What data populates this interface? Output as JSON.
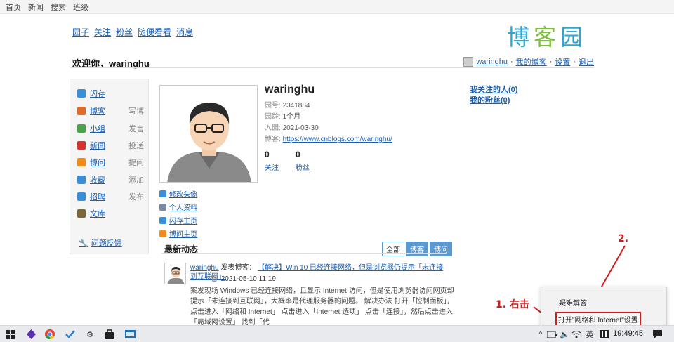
{
  "topbar": [
    "首页",
    "新闻",
    "搜索",
    "班级"
  ],
  "nav": [
    "园子",
    "关注",
    "粉丝",
    "随便看看",
    "消息"
  ],
  "logo": {
    "chars": [
      "博",
      "客",
      "园"
    ],
    "colors": [
      "#2aa7d7",
      "#7bbf3a",
      "#2aa7d7"
    ]
  },
  "welcome": "欢迎你，waringhu",
  "userbar": {
    "username": "waringhu",
    "sep": "·",
    "links": [
      "我的博客",
      "设置",
      "退出"
    ]
  },
  "sidebar": {
    "items": [
      {
        "label": "闪存",
        "action": "",
        "icon": "flash-icon",
        "color": "#3a8fd8"
      },
      {
        "label": "博客",
        "action": "写博",
        "icon": "blog-icon",
        "color": "#e06a2a"
      },
      {
        "label": "小组",
        "action": "发言",
        "icon": "group-icon",
        "color": "#4aa34a"
      },
      {
        "label": "新闻",
        "action": "投递",
        "icon": "news-icon",
        "color": "#d8332c"
      },
      {
        "label": "博问",
        "action": "提问",
        "icon": "question-icon",
        "color": "#f08c1a"
      },
      {
        "label": "收藏",
        "action": "添加",
        "icon": "favorite-icon",
        "color": "#3a8fd8"
      },
      {
        "label": "招聘",
        "action": "发布",
        "icon": "job-icon",
        "color": "#3a8fd8"
      },
      {
        "label": "文库",
        "action": "",
        "icon": "library-icon",
        "color": "#7a6a3a"
      }
    ],
    "feedback": "问题反馈"
  },
  "profile": {
    "name": "waringhu",
    "fields": [
      {
        "k": "园号:",
        "v": "2341884"
      },
      {
        "k": "园龄:",
        "v": "1个月"
      },
      {
        "k": "入园:",
        "v": "2021-03-30"
      },
      {
        "k": "博客:",
        "v": "https://www.cnblogs.com/waringhu/"
      }
    ],
    "follow_count": "0",
    "follow_label": "关注",
    "fans_count": "0",
    "fans_label": "粉丝"
  },
  "profile_links": [
    {
      "label": "修改头像",
      "icon": "edit-avatar-icon",
      "color": "#3a8fd8"
    },
    {
      "label": "个人资料",
      "icon": "profile-card-icon",
      "color": "#7a8aa0"
    },
    {
      "label": "闪存主页",
      "icon": "flash-home-icon",
      "color": "#3a8fd8"
    },
    {
      "label": "博问主页",
      "icon": "question-home-icon",
      "color": "#f08c1a"
    }
  ],
  "right_links": [
    "我关注的人(0)",
    "我的粉丝(0)"
  ],
  "dynamic": {
    "title": "最新动态",
    "tabs": [
      "全部",
      "博客",
      "博问"
    ],
    "user": "waringhu",
    "verb": "发表博客：",
    "post_title": "【解决】Win 10 已经连接网络，但是浏览器仍提示「未连接到互联网」",
    "date": "2021-05-10 11:19",
    "body": "案发现场 Windows 已经连接网络，且显示 Internet 访问，但是使用浏览器访问网页却提示「未连接到互联网」，大概率是代理服务器的问题。 解决办法 打开「控制面板」，点击进入「网络和 Internet」 点击进入「Internet 选项」 点击「连接」，然后点击进入「局域网设置」 找到「代"
  },
  "popup": {
    "item1": "疑难解答",
    "item2": "打开\"网络和 Internet\"设置"
  },
  "annotations": {
    "step1": "1. 右击",
    "step2": "2."
  },
  "taskbar": {
    "icons": [
      "start-icon",
      "app-purple-icon",
      "chrome-icon",
      "check-app-icon",
      "gear-icon",
      "store-icon",
      "terminal-icon"
    ],
    "clock": "19:49:45",
    "ime": "英"
  }
}
